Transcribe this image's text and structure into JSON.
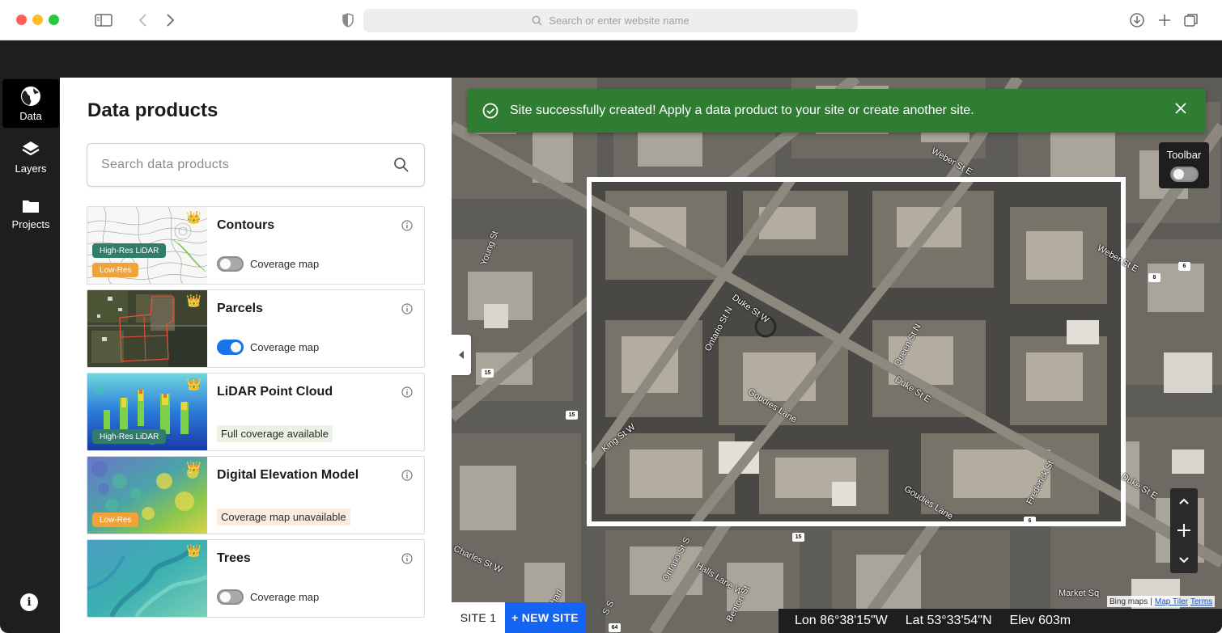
{
  "browser": {
    "url_placeholder": "Search or enter website name"
  },
  "rail": {
    "items": [
      {
        "label": "Data",
        "icon": "globe-icon",
        "active": true
      },
      {
        "label": "Layers",
        "icon": "layers-icon",
        "active": false
      },
      {
        "label": "Projects",
        "icon": "folder-icon",
        "active": false
      }
    ],
    "info_icon": "info-icon"
  },
  "panel": {
    "title": "Data products",
    "search_placeholder": "Search data products",
    "products": [
      {
        "title": "Contours",
        "tags": [
          "High-Res LiDAR",
          "Low-Res"
        ],
        "toggle_label": "Coverage map",
        "toggle_on": false
      },
      {
        "title": "Parcels",
        "tags": [],
        "toggle_label": "Coverage map",
        "toggle_on": true
      },
      {
        "title": "LiDAR Point Cloud",
        "tags": [
          "High-Res LiDAR"
        ],
        "status": "Full coverage available"
      },
      {
        "title": "Digital Elevation Model",
        "tags": [
          "Low-Res"
        ],
        "status": "Coverage map unavailable"
      },
      {
        "title": "Trees",
        "tags": [],
        "toggle_label": "Coverage map",
        "toggle_on": false
      }
    ]
  },
  "map": {
    "toast": "Site successfully created! Apply a data product to your site or create another site.",
    "toolbar_label": "Toolbar",
    "site_tab": "SITE 1",
    "new_site": "+ NEW SITE",
    "lon": "Lon 86°38'15\"W",
    "lat": "Lat 53°33'54\"N",
    "elev": "Elev 603m",
    "attribution_bing": "Bing maps",
    "attribution_sep": "|",
    "attribution_tiler": "Map Tiler",
    "attribution_terms": "Terms",
    "streets": {
      "weber_st_e_top": "Weber St E",
      "weber_st_e_right": "Weber St E",
      "young_st": "Young St",
      "duke_st_w": "Duke St W",
      "ontario_st_n": "Ontario St N",
      "queen_st_n": "Queen St N",
      "duke_st_e": "Duke St E",
      "goudies_lane": "Goudies Lane",
      "goudies_lane_2": "Goudies Lane",
      "king_st_w": "King St W",
      "frederick_st": "Frederick St",
      "duke_st_e_right": "Duke St E",
      "ontario_st_s": "Ontario St S",
      "charles_st_w": "Charles St W",
      "halls_lane_w": "Halls Lane W",
      "market_sq": "Market Sq",
      "charl": "Charl",
      "benton": "Benton St",
      "s_s": "S S"
    },
    "road_signs": [
      "15",
      "15",
      "15",
      "6",
      "8",
      "6",
      "64"
    ],
    "colors": {
      "toast_bg": "#2e7d32",
      "new_site_bg": "#1565f5",
      "toggle_on": "#1a73e8"
    }
  }
}
